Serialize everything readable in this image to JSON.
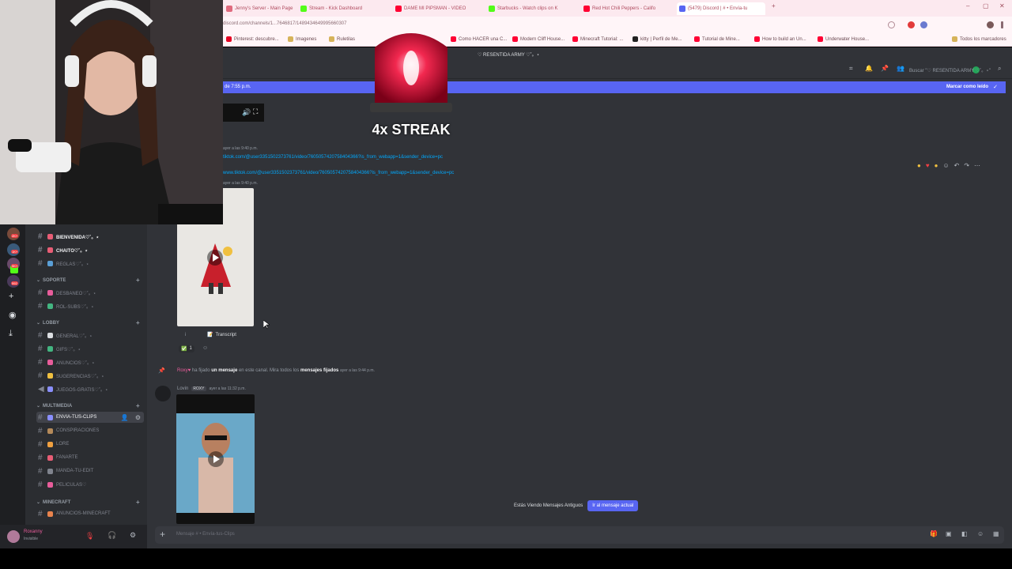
{
  "browser": {
    "tabs": [
      {
        "label": "Jenny's Server - Main Page",
        "fav": "#e06a7e"
      },
      {
        "label": "Stream - Kick Dashboard",
        "fav": "#53fc18"
      },
      {
        "label": "DAME MI PIPSMAN - VIDEO",
        "fav": "#ff0033"
      },
      {
        "label": "Starbucks - Watch clips on K",
        "fav": "#53fc18"
      },
      {
        "label": "Red Hot Chili Peppers - Califo",
        "fav": "#ff0033"
      },
      {
        "label": "(5479) Discord | # • Envía-tu",
        "fav": "#5865f2"
      }
    ],
    "url": "discord.com/channels/1...7646817/1489434649995660307",
    "bookmarks": [
      {
        "label": "Pinterest: descubre...",
        "fav": "#e60023"
      },
      {
        "label": "Imagenes",
        "fav": "#d6b35a"
      },
      {
        "label": "Ruletilas",
        "fav": "#d6b35a"
      },
      {
        "label": "Como HACER una C...",
        "fav": "#ff0033"
      },
      {
        "label": "Modern Cliff House...",
        "fav": "#ff0033"
      },
      {
        "label": "Minecraft Tutorial: ...",
        "fav": "#ff0033"
      },
      {
        "label": "kitty | Perfil de Me...",
        "fav": "#222222"
      },
      {
        "label": "Tutorial de Mine...",
        "fav": "#ff0033"
      },
      {
        "label": "How to build an Un...",
        "fav": "#ff0033"
      },
      {
        "label": "Underwater House...",
        "fav": "#ff0033"
      },
      {
        "label": "Todos los marcadores",
        "fav": "#d6b35a"
      }
    ]
  },
  "server": {
    "title": "♡ RESENTIDA ARMY ♡˚。⋆",
    "search_placeholder": "Buscar \"♡ RESENTIDA ARMY ♡˚。⋆\"",
    "servers": [
      {
        "badge": "2K+",
        "color": "#7a4a3a"
      },
      {
        "badge": "1K+",
        "color": "#3a5a7a"
      },
      {
        "badge": "5K+",
        "color": "#6a4a6a"
      },
      {
        "badge": "",
        "color": "#53fc18"
      },
      {
        "badge": "592",
        "color": "#4a3a5a"
      }
    ]
  },
  "channels": {
    "top": [
      {
        "label": "INICIO",
        "type": "cat"
      },
      {
        "label": "BIENVENIDA♡˚。⋆",
        "emo": "#e85d75",
        "unread": true
      },
      {
        "label": "CHAITO♡˚。⋆",
        "emo": "#e85d75",
        "unread": true
      },
      {
        "label": "REGLAS♡˚。⋆",
        "emo": "#5a9fd6",
        "unread": false
      }
    ],
    "soporte": {
      "label": "SOPORTE",
      "items": [
        {
          "label": "DESBANEO♡˚。⋆",
          "emo": "#e85d9b"
        },
        {
          "label": "ROL-SUBS♡˚。⋆",
          "emo": "#43b581"
        }
      ]
    },
    "lobby": {
      "label": "LOBBY",
      "items": [
        {
          "label": "GENERAL♡˚。⋆",
          "emo": "#dbdee1"
        },
        {
          "label": "GIFS♡˚。⋆",
          "emo": "#43b581"
        },
        {
          "label": "ANUNCIOS♡˚。⋆",
          "emo": "#e85d9b"
        },
        {
          "label": "SUGERENCIAS♡˚。⋆",
          "emo": "#f0c040"
        },
        {
          "label": "JUEGOS-GRATIS♡˚。⋆",
          "emo": "#8a8fff"
        }
      ]
    },
    "multimedia": {
      "label": "MULTIMEDIA",
      "items": [
        {
          "label": "ENVIA-TUS-CLIPS",
          "emo": "#8a8fff",
          "active": true
        },
        {
          "label": "CONSPIRACIONES",
          "emo": "#b58a5a"
        },
        {
          "label": "LORE",
          "emo": "#f0a040"
        },
        {
          "label": "FANARTE",
          "emo": "#e85d75"
        },
        {
          "label": "MANDA-TU-EDIT",
          "emo": "#80848e"
        },
        {
          "label": "PELICULAS♡",
          "emo": "#e85d9b"
        }
      ]
    },
    "minecraft": {
      "label": "MINECRAFT",
      "items": [
        {
          "label": "ANUNCIOS-MINECRAFT",
          "emo": "#e8834d"
        }
      ]
    }
  },
  "user": {
    "name": "Roxanny",
    "status": "Invisible"
  },
  "overlay": {
    "streak": "4x STREAK"
  },
  "chat": {
    "new_messages_bar": "de 7:55 p.m.",
    "mark_read": "Marcar como leído",
    "msg1_time": "ayer a las 9:40 p.m.",
    "msg1_link": "tiktok.com/@user3351502373761/video/7605057420758404366?is_from_webapp=1&sender_device=pc",
    "msg2_link": "www.tiktok.com/@user3351502373761/video/7605057420758404366?is_from_webapp=1&sender_device=pc",
    "msg2_time": "ayer a las 9:40 p.m.",
    "transcript": "Transcript",
    "reaction_count": "1",
    "pin_user": "Roxy♥",
    "pin_text1": "ha fijado",
    "pin_text2": "un mensaje",
    "pin_text3": "en este canal. Mira todos los",
    "pin_text4": "mensajes fijados",
    "pin_time": "ayer a las 9:44 p.m.",
    "msg3_user": "Lovin",
    "msg3_tag": "ROXY",
    "msg3_time": "ayer a las 11:32 p.m.",
    "older_notice": "Estás Viendo Mensajes Antiguos",
    "jump_button": "Ir al mensaje actual",
    "composer_placeholder": "Mensaje #",
    "composer_channel": "• Envía-tus-Clips"
  }
}
